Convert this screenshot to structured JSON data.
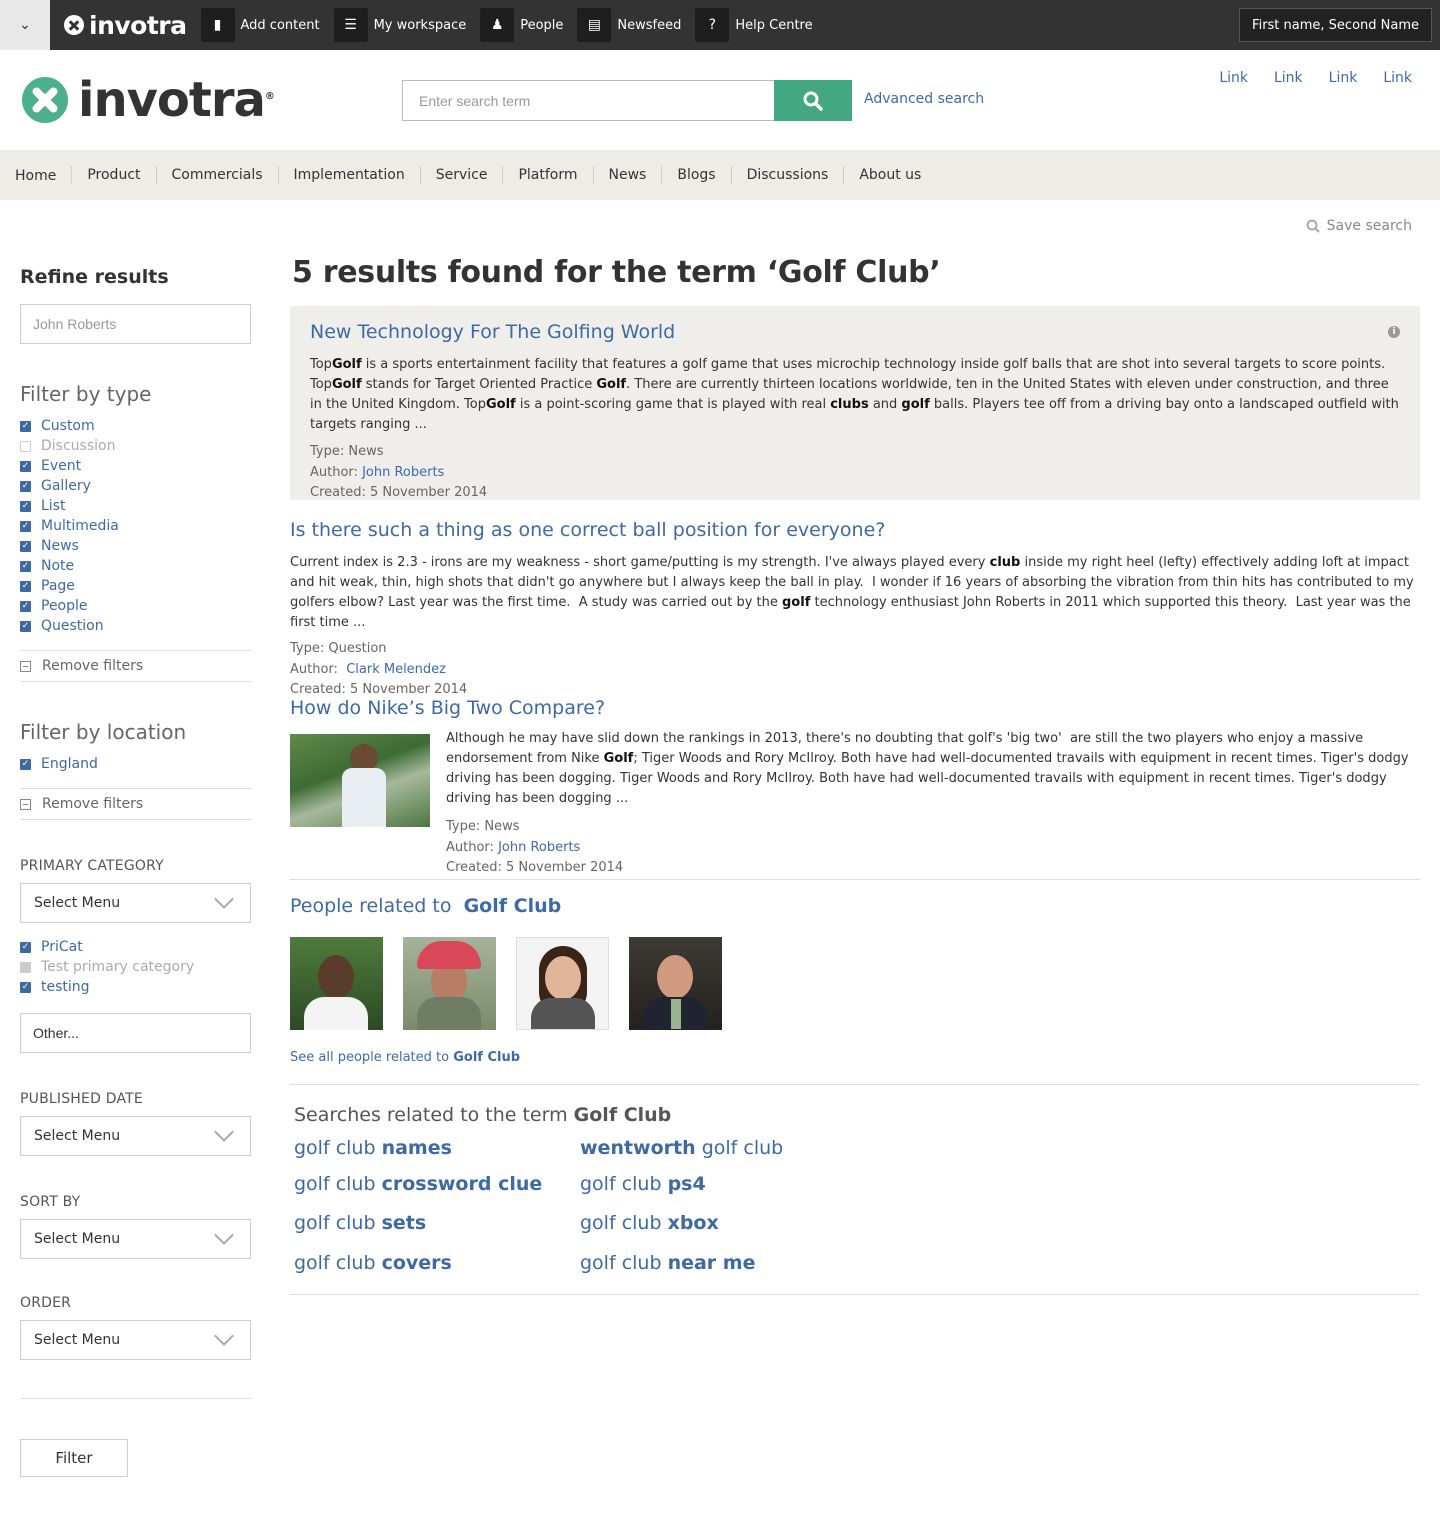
{
  "adminbar": {
    "logo": "invotra",
    "items": [
      {
        "label": "Add content",
        "icon": "document-icon"
      },
      {
        "label": "My workspace",
        "icon": "list-icon"
      },
      {
        "label": "People",
        "icon": "people-icon"
      },
      {
        "label": "Newsfeed",
        "icon": "newspaper-icon"
      },
      {
        "label": "Help Centre",
        "icon": "help-icon"
      }
    ],
    "user": "First name, Second Name"
  },
  "header": {
    "logo": "invotra",
    "search_placeholder": "Enter search term",
    "advanced_search": "Advanced search",
    "links": [
      "Link",
      "Link",
      "Link",
      "Link"
    ]
  },
  "nav": [
    "Home",
    "Product",
    "Commercials",
    "Implementation",
    "Service",
    "Platform",
    "News",
    "Blogs",
    "Discussions",
    "About us"
  ],
  "save_search": "Save search",
  "sidebar": {
    "title": "Refine results",
    "name_filter": "John Roberts",
    "filter_type_heading": "Filter by type",
    "types": [
      {
        "label": "Custom",
        "checked": true
      },
      {
        "label": "Discussion",
        "checked": false
      },
      {
        "label": "Event",
        "checked": true
      },
      {
        "label": "Gallery",
        "checked": true
      },
      {
        "label": "List",
        "checked": true
      },
      {
        "label": "Multimedia",
        "checked": true
      },
      {
        "label": "News",
        "checked": true
      },
      {
        "label": "Note",
        "checked": true
      },
      {
        "label": "Page",
        "checked": true
      },
      {
        "label": "People",
        "checked": true
      },
      {
        "label": "Question",
        "checked": true
      }
    ],
    "remove_filters": "Remove filters",
    "filter_location_heading": "Filter by location",
    "locations": [
      {
        "label": "England",
        "checked": true
      }
    ],
    "primary_category_label": "PRIMARY CATEGORY",
    "select_menu": "Select Menu",
    "categories": [
      {
        "label": "PriCat",
        "checked": true
      },
      {
        "label": "Test primary category",
        "checked": false
      },
      {
        "label": "testing",
        "checked": true
      }
    ],
    "other_placeholder": "Other...",
    "published_date_label": "PUBLISHED DATE",
    "sort_by_label": "SORT BY",
    "order_label": "ORDER",
    "filter_button": "Filter"
  },
  "results_title": "5 results found for the term ‘Golf Club’",
  "results": [
    {
      "title": "New Technology For The Golfing World",
      "type": "Type: News",
      "author_label": "Author:",
      "author": "John Roberts",
      "created": "Created: 5 November 2014"
    },
    {
      "title": "Is there such a thing as one correct ball position for everyone?",
      "type": "Type: Question",
      "author_label": "Author:",
      "author": "Clark Melendez",
      "created": "Created: 5 November 2014"
    },
    {
      "title": "How do Nike’s Big Two Compare?",
      "type": "Type: News",
      "author_label": "Author:",
      "author": "John Roberts",
      "created": "Created: 5 November 2014"
    }
  ],
  "people": {
    "title_prefix": "People related to",
    "term": "Golf Club",
    "see_all_prefix": "See all people related to"
  },
  "related": {
    "title_prefix": "Searches related to the term",
    "term": "Golf Club",
    "base": "golf club",
    "left": [
      "names",
      "crossword clue",
      "sets",
      "covers"
    ],
    "right": [
      {
        "pre": "wentworth",
        "post": "golf club"
      },
      {
        "pre": "golf club",
        "post": "ps4"
      },
      {
        "pre": "golf club",
        "post": "xbox"
      },
      {
        "pre": "golf club",
        "post": "near me"
      }
    ]
  },
  "colors": {
    "accent": "#3d6aa5",
    "brand_green": "#43a882",
    "dark_bar": "#333333"
  }
}
